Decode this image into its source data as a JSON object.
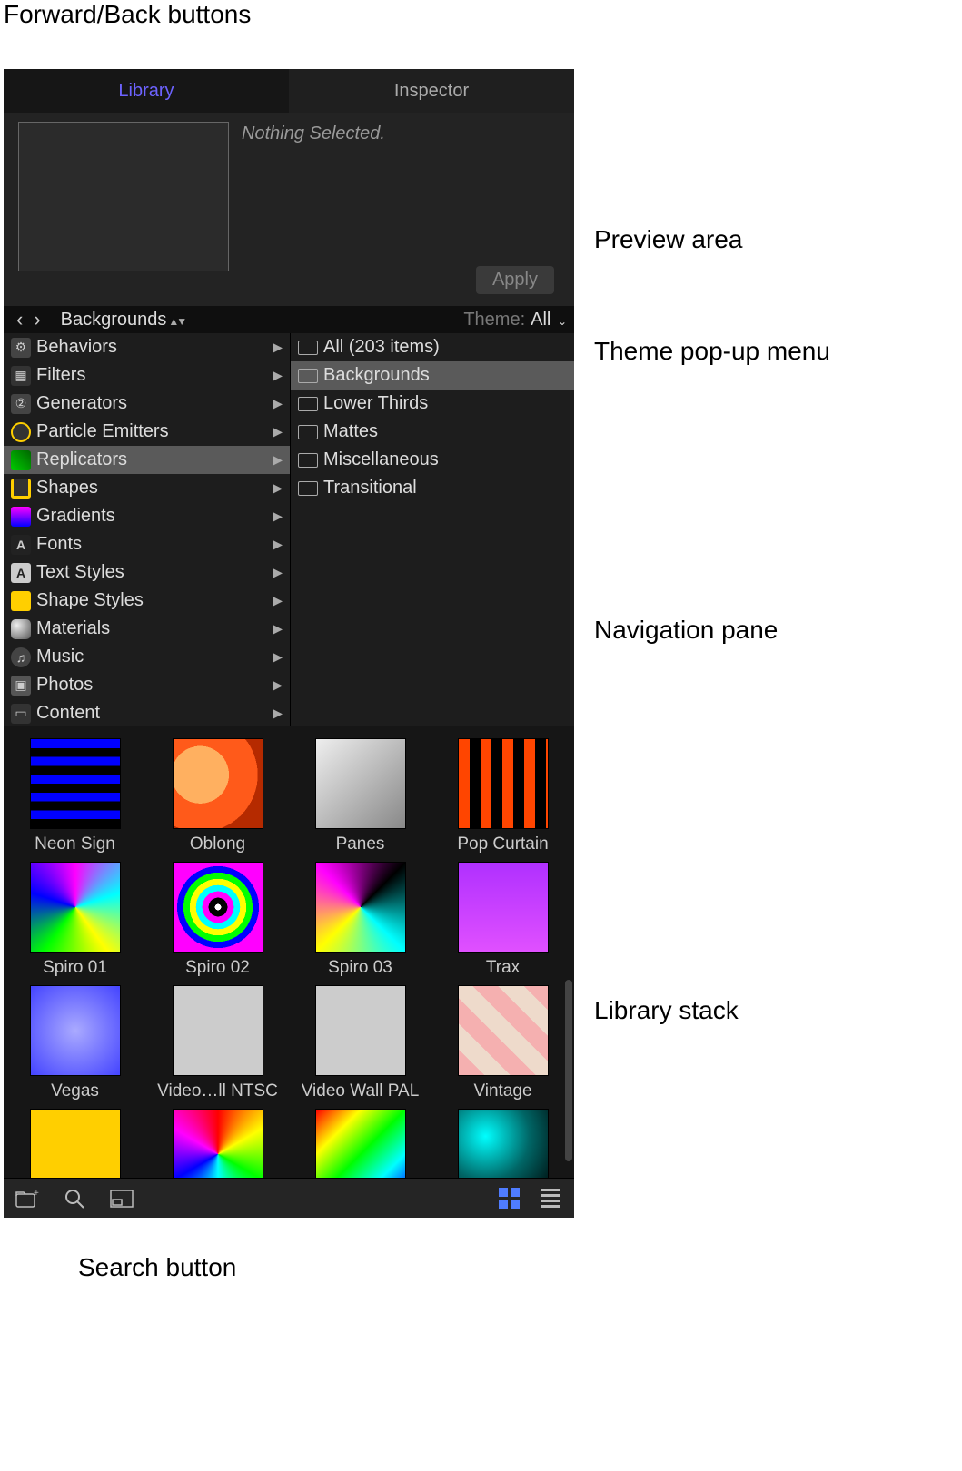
{
  "annotations": {
    "forward_back": "Forward/Back buttons",
    "preview": "Preview area",
    "theme_popup": "Theme pop-up menu",
    "navigation": "Navigation pane",
    "library_stack": "Library stack",
    "search": "Search button"
  },
  "tabs": {
    "library": "Library",
    "inspector": "Inspector"
  },
  "preview": {
    "status": "Nothing Selected.",
    "apply": "Apply"
  },
  "themebar": {
    "breadcrumb": "Backgrounds",
    "theme_label": "Theme:",
    "theme_value": "All"
  },
  "categories": [
    {
      "label": "Behaviors",
      "icon": "ci-behaviors"
    },
    {
      "label": "Filters",
      "icon": "ci-filters"
    },
    {
      "label": "Generators",
      "icon": "ci-gen"
    },
    {
      "label": "Particle Emitters",
      "icon": "ci-part"
    },
    {
      "label": "Replicators",
      "icon": "ci-rep",
      "selected": true
    },
    {
      "label": "Shapes",
      "icon": "ci-shape"
    },
    {
      "label": "Gradients",
      "icon": "ci-grad"
    },
    {
      "label": "Fonts",
      "icon": "ci-font"
    },
    {
      "label": "Text Styles",
      "icon": "ci-tstyle"
    },
    {
      "label": "Shape Styles",
      "icon": "ci-sstyle"
    },
    {
      "label": "Materials",
      "icon": "ci-mat"
    },
    {
      "label": "Music",
      "icon": "ci-music"
    },
    {
      "label": "Photos",
      "icon": "ci-photo"
    },
    {
      "label": "Content",
      "icon": "ci-content"
    }
  ],
  "subcategories": [
    {
      "label": "All (203 items)"
    },
    {
      "label": "Backgrounds",
      "selected": true
    },
    {
      "label": "Lower Thirds"
    },
    {
      "label": "Mattes"
    },
    {
      "label": "Miscellaneous"
    },
    {
      "label": "Transitional"
    }
  ],
  "stack": [
    {
      "label": "Neon Sign",
      "thumb": "t-neon"
    },
    {
      "label": "Oblong",
      "thumb": "t-oblong"
    },
    {
      "label": "Panes",
      "thumb": "t-panes"
    },
    {
      "label": "Pop Curtain",
      "thumb": "t-pop"
    },
    {
      "label": "Spiro 01",
      "thumb": "t-sp1"
    },
    {
      "label": "Spiro 02",
      "thumb": "t-sp2"
    },
    {
      "label": "Spiro 03",
      "thumb": "t-sp3"
    },
    {
      "label": "Trax",
      "thumb": "t-trax"
    },
    {
      "label": "Vegas",
      "thumb": "t-vegas"
    },
    {
      "label": "Video…ll NTSC",
      "thumb": "t-vwn"
    },
    {
      "label": "Video Wall PAL",
      "thumb": "t-vwp"
    },
    {
      "label": "Vintage",
      "thumb": "t-vint"
    },
    {
      "label": "",
      "thumb": "t-yel"
    },
    {
      "label": "",
      "thumb": "t-rain1"
    },
    {
      "label": "",
      "thumb": "t-rain2"
    },
    {
      "label": "",
      "thumb": "t-teal"
    }
  ]
}
